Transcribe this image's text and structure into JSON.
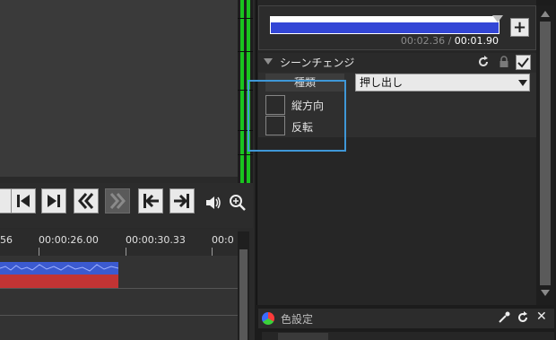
{
  "transport": {
    "buttons": [
      {
        "name": "prev-frame-button",
        "icon": "step-back-icon"
      },
      {
        "name": "next-frame-button",
        "icon": "step-forward-icon"
      },
      {
        "name": "rewind-button",
        "icon": "rewind-icon"
      },
      {
        "name": "fast-forward-button",
        "icon": "fast-forward-icon",
        "disabled": true
      },
      {
        "name": "go-to-start-button",
        "icon": "skip-start-icon"
      },
      {
        "name": "go-to-end-button",
        "icon": "skip-end-icon"
      }
    ],
    "volume_icon": "volume-icon",
    "zoom_icon": "zoom-icon"
  },
  "timeline": {
    "ruler_labels": [
      "56",
      "00:00:26.00",
      "00:00:30.33",
      "00:0"
    ],
    "clip_colors": {
      "audio_top": "#3b5ad0",
      "audio_bottom": "#c23434"
    }
  },
  "seek": {
    "current_time": "00:02.36",
    "separator": " / ",
    "total_time": "00:01.90",
    "add_button": "+",
    "fill_color": "#3346d6"
  },
  "effect": {
    "title": "シーンチェンジ",
    "type_label": "種類",
    "type_value": "押し出し",
    "enabled": true,
    "options": [
      {
        "label": "縦方向",
        "checked": false
      },
      {
        "label": "反転",
        "checked": false
      }
    ]
  },
  "color_panel": {
    "title": "色設定",
    "close_label": "✕"
  },
  "accent": {
    "highlight": "#3f97d7",
    "meter_green": "#19c41f"
  }
}
